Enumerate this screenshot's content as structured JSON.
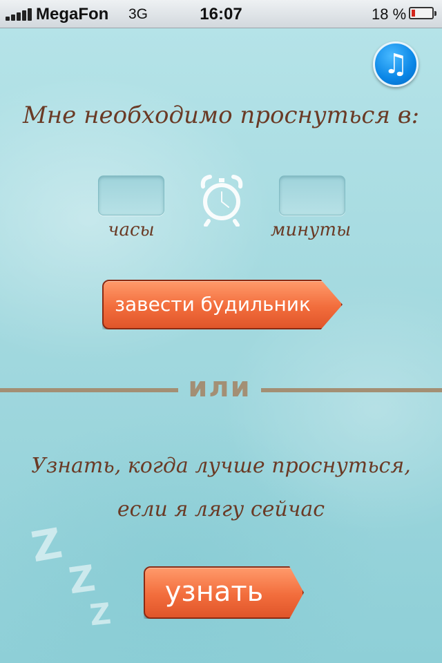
{
  "status_bar": {
    "carrier": "MegaFon",
    "network": "3G",
    "time": "16:07",
    "battery_percent": "18 %",
    "battery_level": 0.18,
    "signal_icon": "signal-bars-icon",
    "battery_icon": "battery-low-icon"
  },
  "music_button": {
    "icon": "music-note-icon",
    "glyph": "♫"
  },
  "alarm": {
    "headline": "Мне необходимо проснуться в:",
    "hours_label": "часы",
    "minutes_label": "минуты",
    "hours_value": "",
    "minutes_value": "",
    "clock_icon": "alarm-clock-icon",
    "set_button": "завести будильник"
  },
  "divider": {
    "label": "или"
  },
  "sleep_now": {
    "line1": "Узнать, когда лучше проснуться,",
    "line2": "если я лягу сейчас",
    "button": "узнать",
    "decor_z": [
      "Z",
      "Z",
      "Z"
    ]
  },
  "colors": {
    "accent_button": "#f26d3c",
    "text_brown": "#6a3a25",
    "divider": "#a38f74",
    "music_blue": "#0a86e6"
  }
}
